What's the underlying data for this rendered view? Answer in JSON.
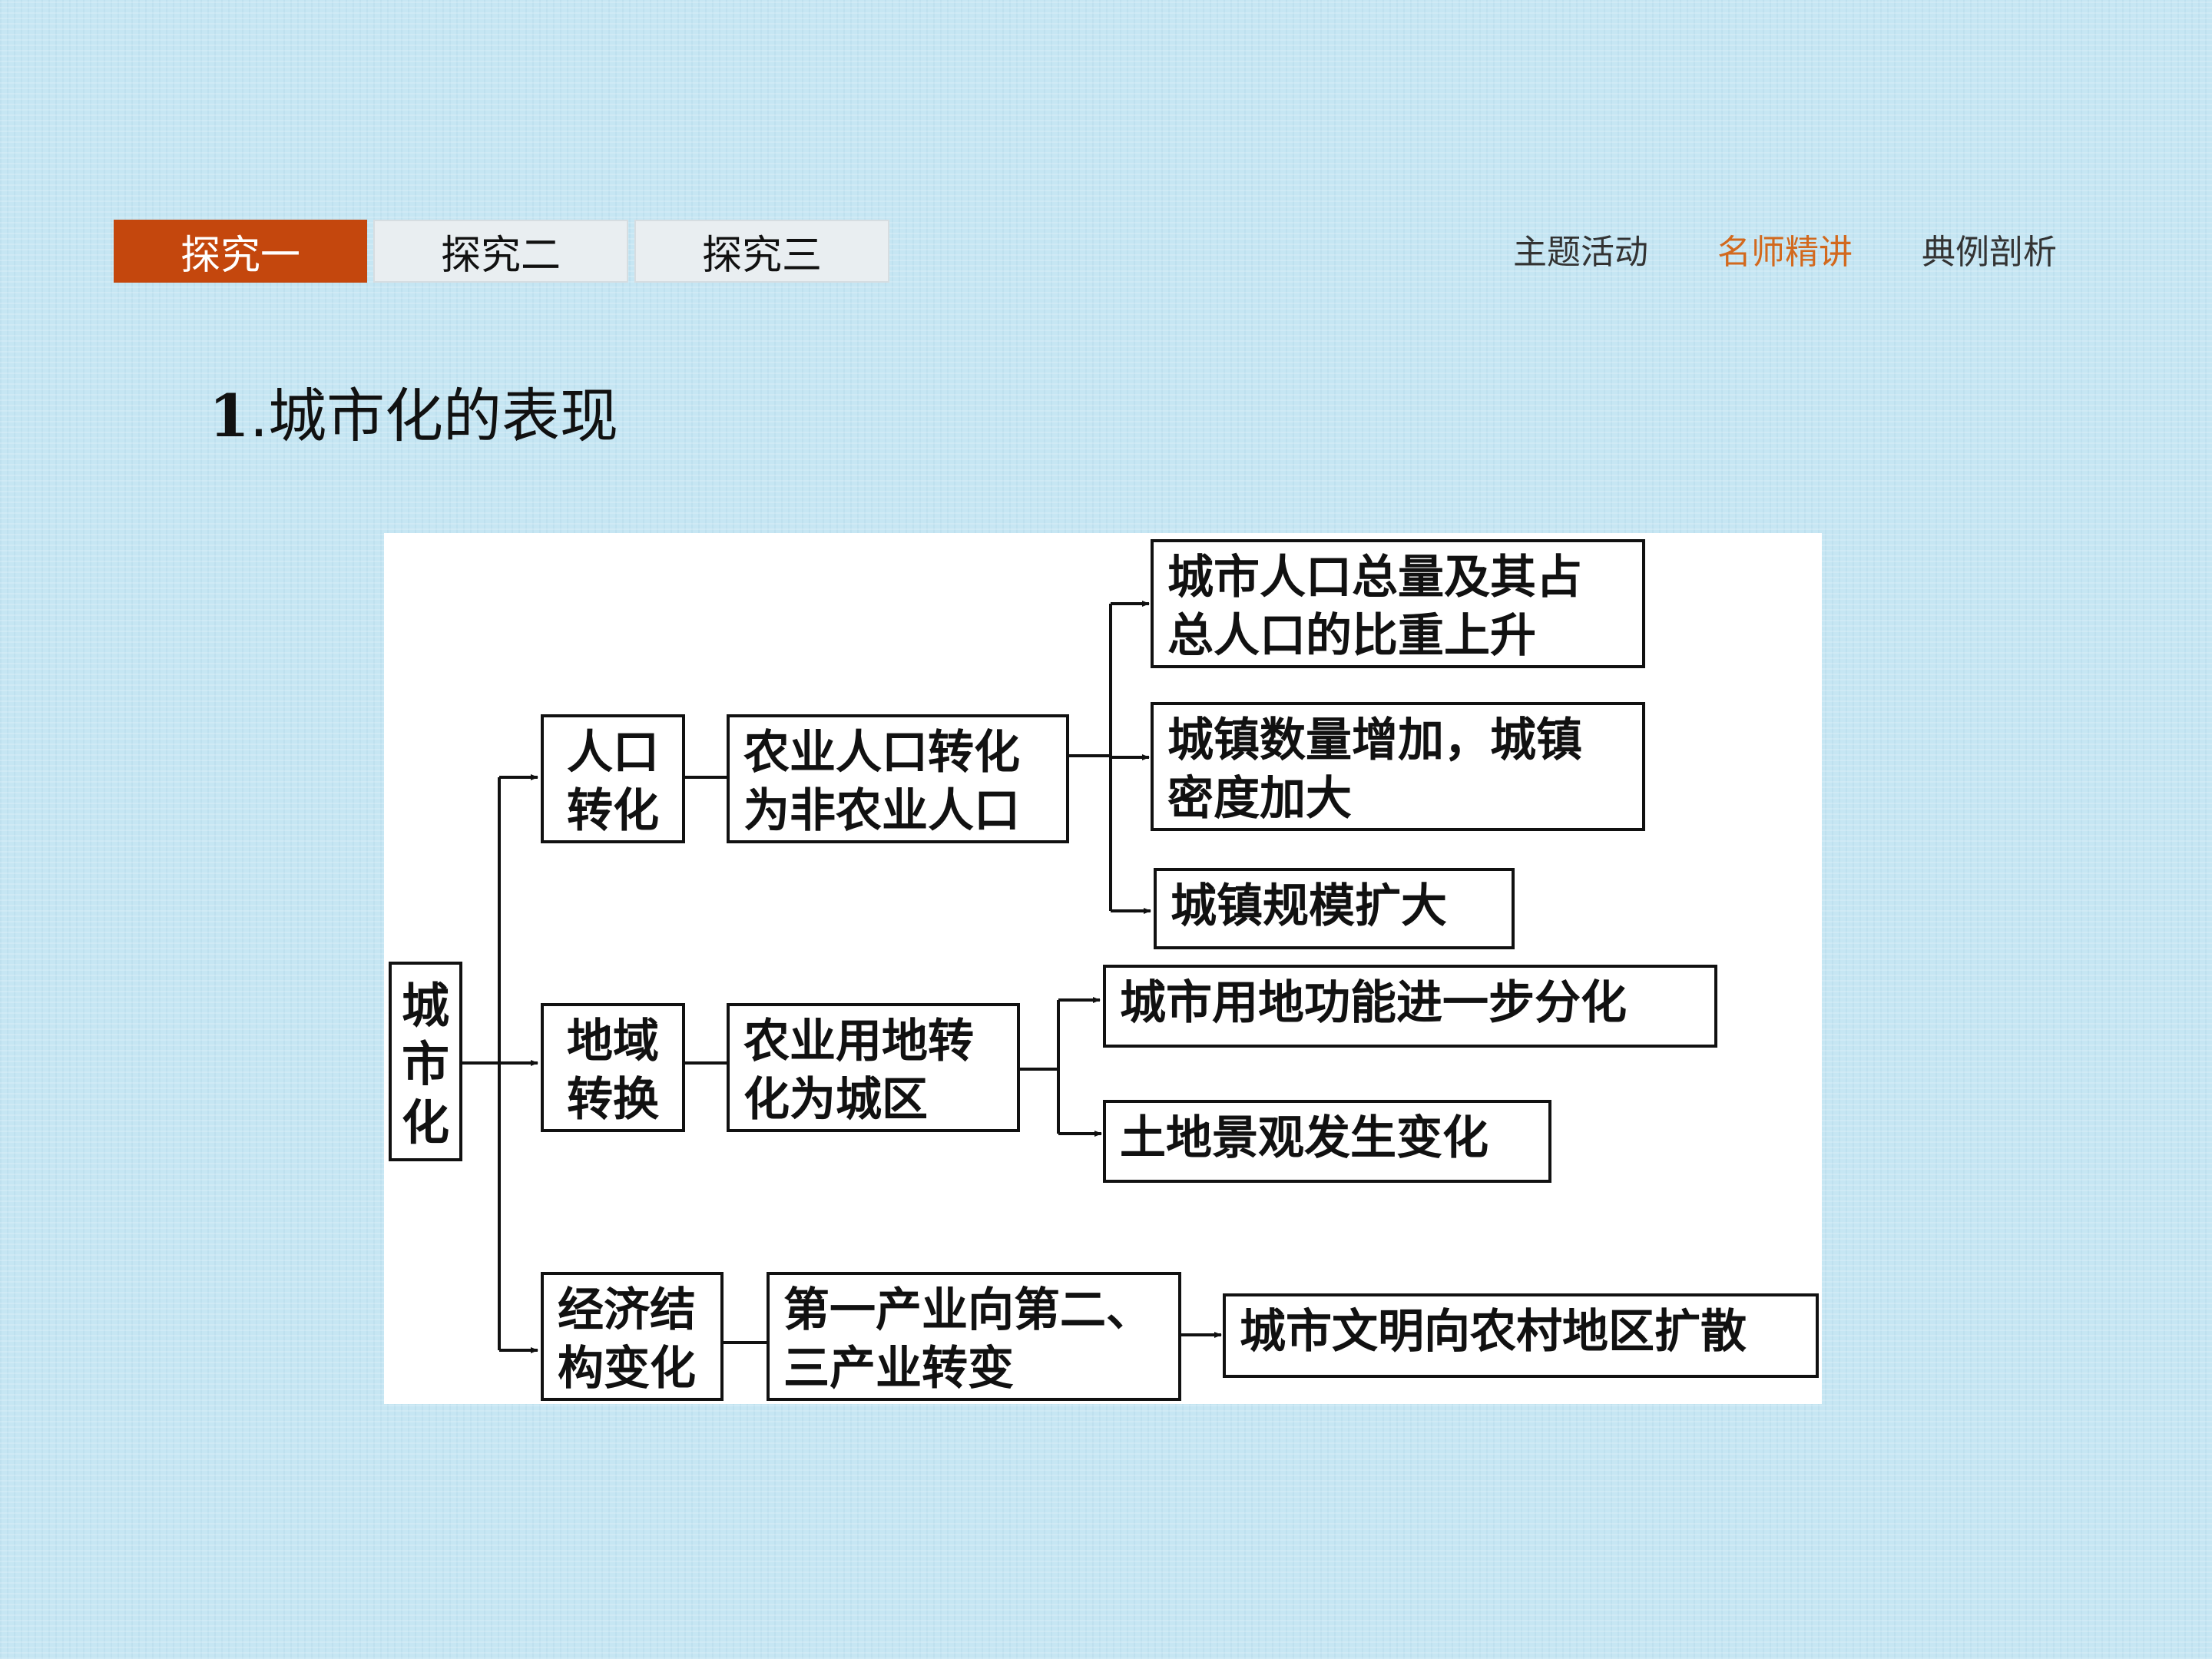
{
  "tabs": [
    "探究一",
    "探究二",
    "探究三"
  ],
  "nav": [
    "主题活动",
    "名师精讲",
    "典例剖析"
  ],
  "heading": {
    "number": "1",
    "text": ".城市化的表现"
  },
  "diagram": {
    "root": [
      "城",
      "市",
      "化"
    ],
    "branches": [
      {
        "label": [
          "人口",
          "转化"
        ],
        "change": [
          "农业人口转化",
          "为非农业人口"
        ],
        "results": [
          [
            "城市人口总量及其占",
            "总人口的比重上升"
          ],
          [
            "城镇数量增加，城镇",
            "密度加大"
          ],
          [
            "城镇规模扩大"
          ]
        ]
      },
      {
        "label": [
          "地域",
          "转换"
        ],
        "change": [
          "农业用地转",
          "化为城区"
        ],
        "results": [
          [
            "城市用地功能进一步分化"
          ],
          [
            "土地景观发生变化"
          ]
        ]
      },
      {
        "label": [
          "经济结",
          "构变化"
        ],
        "change": [
          "第一产业向第二、",
          "三产业转变"
        ],
        "results": [
          [
            "城市文明向农村地区扩散"
          ]
        ]
      }
    ]
  }
}
